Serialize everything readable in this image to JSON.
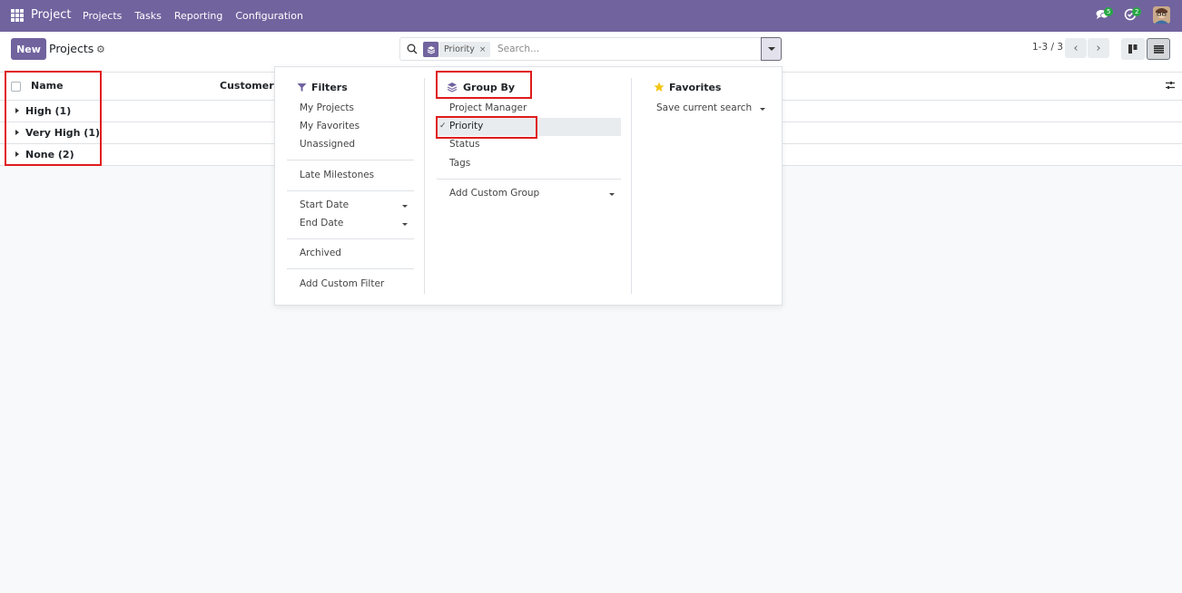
{
  "navbar": {
    "brand": "Project",
    "menu": [
      "Projects",
      "Tasks",
      "Reporting",
      "Configuration"
    ],
    "messages_count": "5",
    "activities_count": "2"
  },
  "control_panel": {
    "new_label": "New",
    "title": "Projects",
    "search": {
      "facet_value": "Priority",
      "facet_remove": "×",
      "placeholder": "Search..."
    },
    "pager": "1-3 / 3"
  },
  "list": {
    "columns": [
      "Name",
      "Customer"
    ],
    "groups": [
      {
        "label": "High (1)"
      },
      {
        "label": "Very High (1)"
      },
      {
        "label": "None (2)"
      }
    ]
  },
  "search_panel": {
    "filters": {
      "title": "Filters",
      "items": [
        "My Projects",
        "My Favorites",
        "Unassigned",
        "Late Milestones",
        "Start Date",
        "End Date",
        "Archived",
        "Add Custom Filter"
      ]
    },
    "group_by": {
      "title": "Group By",
      "items": [
        "Project Manager",
        "Priority",
        "Status",
        "Tags"
      ],
      "selected": "Priority",
      "checkmark": "✓",
      "custom_group": "Add Custom Group"
    },
    "favorites": {
      "title": "Favorites",
      "items": [
        "Save current search"
      ]
    }
  },
  "colors": {
    "brand": "#71639e",
    "highlight": "#e01b1b",
    "badge": "#28a745",
    "star": "#f3c614"
  }
}
